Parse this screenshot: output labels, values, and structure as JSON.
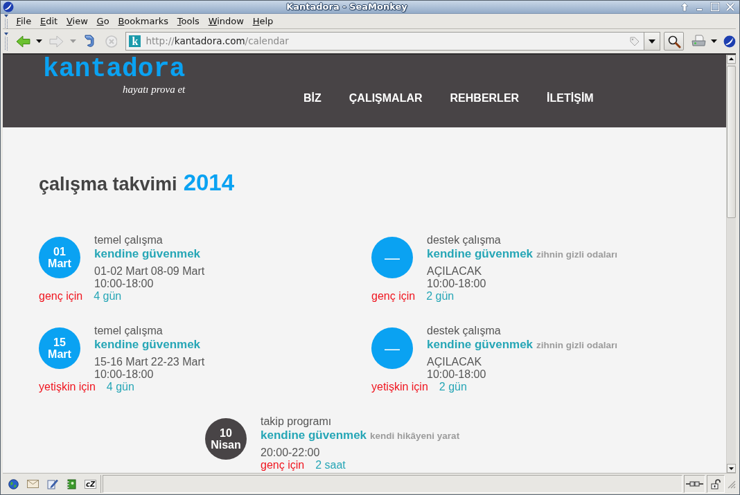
{
  "window": {
    "title": "Kantadora - SeaMonkey"
  },
  "menu_bar": [
    "File",
    "Edit",
    "View",
    "Go",
    "Bookmarks",
    "Tools",
    "Window",
    "Help"
  ],
  "address_bar": {
    "favicon_letter": "k",
    "scheme": "http://",
    "domain": "kantadora.com",
    "path": "/calendar"
  },
  "site_header": {
    "logo": "kantadora",
    "tagline": "hayatı prova et",
    "nav": [
      "BİZ",
      "ÇALIŞMALAR",
      "REHBERLER",
      "İLETİŞİM"
    ]
  },
  "calendar": {
    "heading": "çalışma takvimi",
    "year": "2014",
    "events": [
      {
        "badge": [
          "01",
          "Mart"
        ],
        "color": "#0aa2f2",
        "type": "temel çalışma",
        "title": "kendine güvenmek",
        "dates": "01-02 Mart 08-09 Mart",
        "time": "10:00-18:00",
        "audience": "genç için",
        "duration": "4 gün"
      },
      {
        "badge": [
          "—"
        ],
        "color": "#0aa2f2",
        "type": "destek çalışma",
        "title": "kendine güvenmek",
        "subtitle": "zihnin gizli odaları",
        "dates": "AÇILACAK",
        "time": "10:00-18:00",
        "audience": "genç için",
        "duration": "2 gün"
      },
      {
        "badge": [
          "15",
          "Mart"
        ],
        "color": "#0aa2f2",
        "type": "temel çalışma",
        "title": "kendine güvenmek",
        "dates": "15-16 Mart 22-23 Mart",
        "time": "10:00-18:00",
        "audience": "yetişkin için",
        "duration": "4 gün"
      },
      {
        "badge": [
          "—"
        ],
        "color": "#0aa2f2",
        "type": "destek çalışma",
        "title": "kendine güvenmek",
        "subtitle": "zihnin gizli odaları",
        "dates": "AÇILACAK",
        "time": "10:00-18:00",
        "audience": "yetişkin için",
        "duration": "2 gün"
      },
      {
        "badge": [
          "10",
          "Nisan"
        ],
        "color": "#484446",
        "type": "takip programı",
        "title": "kendine güvenmek",
        "subtitle": "kendi hikâyeni yarat",
        "time": "20:00-22:00",
        "audience": "genç için",
        "duration": "2 saat"
      }
    ]
  },
  "status_bar": {
    "chat_label": "cZ"
  }
}
